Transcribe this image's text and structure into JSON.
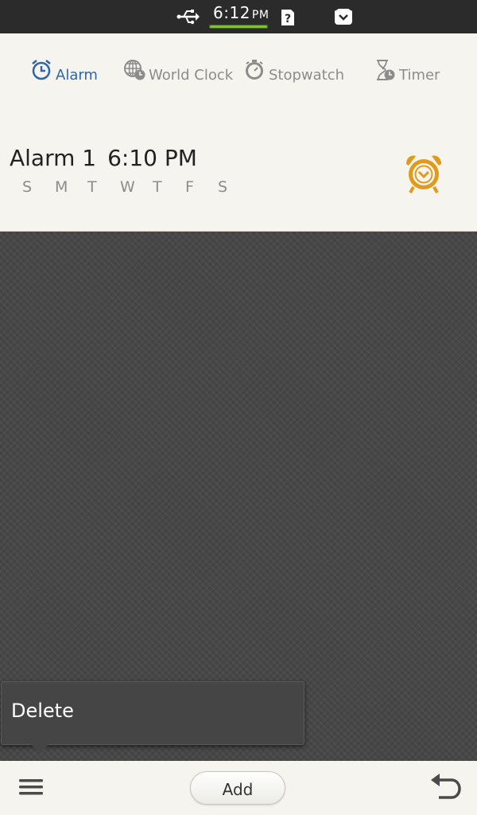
{
  "status_bar": {
    "time": "6:12",
    "ampm": "PM",
    "icons": [
      "usb-icon",
      "sim-unknown-icon",
      "alarm-icon"
    ]
  },
  "tabs": [
    {
      "label": "Alarm",
      "icon": "alarm-clock-icon",
      "selected": true
    },
    {
      "label": "World Clock",
      "icon": "globe-clock-icon",
      "selected": false
    },
    {
      "label": "Stopwatch",
      "icon": "stopwatch-icon",
      "selected": false
    },
    {
      "label": "Timer",
      "icon": "hourglass-icon",
      "selected": false
    }
  ],
  "alarms": [
    {
      "name": "Alarm 1",
      "time": "6:10 PM",
      "days": [
        "S",
        "M",
        "T",
        "W",
        "T",
        "F",
        "S"
      ],
      "enabled": true,
      "accent_color": "#e09a1c"
    }
  ],
  "popup_menu": {
    "delete_label": "Delete"
  },
  "bottom_bar": {
    "add_label": "Add",
    "menu_icon": "menu-icon",
    "back_icon": "back-arrow-icon"
  },
  "colors": {
    "accent_blue": "#2f66a8",
    "status_green": "#7ec235"
  }
}
